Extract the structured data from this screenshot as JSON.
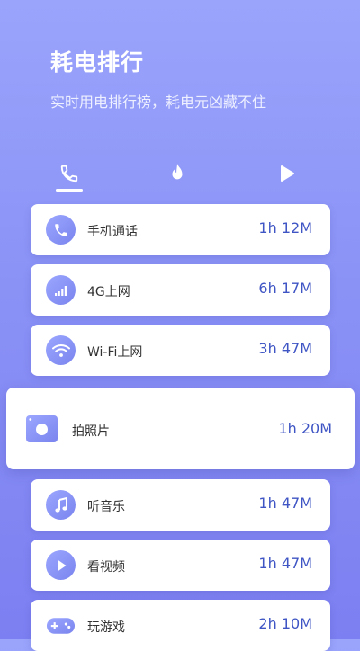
{
  "header": {
    "title": "耗电排行",
    "subtitle": "实时用电排行榜，耗电元凶藏不住"
  },
  "tabs": [
    {
      "icon": "phone-icon",
      "active": true
    },
    {
      "icon": "flame-icon",
      "active": false
    },
    {
      "icon": "play-icon",
      "active": false
    }
  ],
  "items": [
    {
      "label": "手机通话",
      "time": "1h 12M",
      "icon": "phone-icon"
    },
    {
      "label": "4G上网",
      "time": "6h 17M",
      "icon": "signal-bars-icon"
    },
    {
      "label": "Wi-Fi上网",
      "time": "3h 47M",
      "icon": "wifi-icon"
    },
    {
      "label": "拍照片",
      "time": "1h 20M",
      "icon": "camera-icon"
    },
    {
      "label": "听音乐",
      "time": "1h 47M",
      "icon": "music-note-icon"
    },
    {
      "label": "看视频",
      "time": "1h 47M",
      "icon": "play-circle-icon"
    },
    {
      "label": "玩游戏",
      "time": "2h 10M",
      "icon": "gamepad-icon"
    }
  ],
  "colors": {
    "accent_time": "#3f55c4",
    "icon_gradient_start": "#9ba7ff",
    "icon_gradient_end": "#7a84ee",
    "background_top": "#9aa4fb",
    "background_bottom": "#7c7ff1"
  }
}
